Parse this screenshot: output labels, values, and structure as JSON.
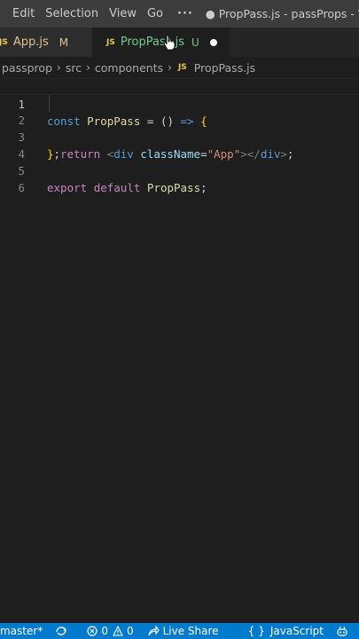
{
  "menu": {
    "items": [
      "Edit",
      "Selection",
      "View",
      "Go"
    ],
    "more": "···",
    "title": "● PropPass.js - passProps - Vis"
  },
  "tabs": [
    {
      "badge": "JS",
      "name": "App.js",
      "flag": "M",
      "state": "modified"
    },
    {
      "badge": "JS",
      "name": "PropPass.js",
      "flag": "U",
      "state": "untracked-unsaved"
    }
  ],
  "breadcrumb": {
    "items": [
      "passprop",
      "src",
      "components"
    ],
    "file_badge": "JS",
    "file": "PropPass.js"
  },
  "editor": {
    "active_line": 1,
    "line_numbers": [
      "1",
      "2",
      "3",
      "4",
      "5",
      "6"
    ],
    "lines": [
      {
        "t1": "const ",
        "t2": "PropPass",
        "t3": " = () ",
        "t4": "=>",
        "t5": " {"
      },
      {
        "t1": "return ",
        "t2": "<",
        "t3": "div",
        "t4": " className",
        "t5": "=",
        "t6": "\"App\"",
        "t7": "></",
        "t8": "div",
        "t9": ">",
        "t10": ";"
      },
      {
        "t1": "}",
        "t2": ";"
      },
      {},
      {
        "t1": "export ",
        "t2": "default ",
        "t3": "PropPass",
        "t4": ";"
      },
      {}
    ]
  },
  "status": {
    "branch": "master*",
    "errors": "0",
    "warnings": "0",
    "live_share": "Live Share",
    "language": "JavaScript"
  },
  "colors": {
    "status_bar": "#007acc",
    "editor_bg": "#1e1e1e",
    "js_badge": "#e8c94a"
  }
}
